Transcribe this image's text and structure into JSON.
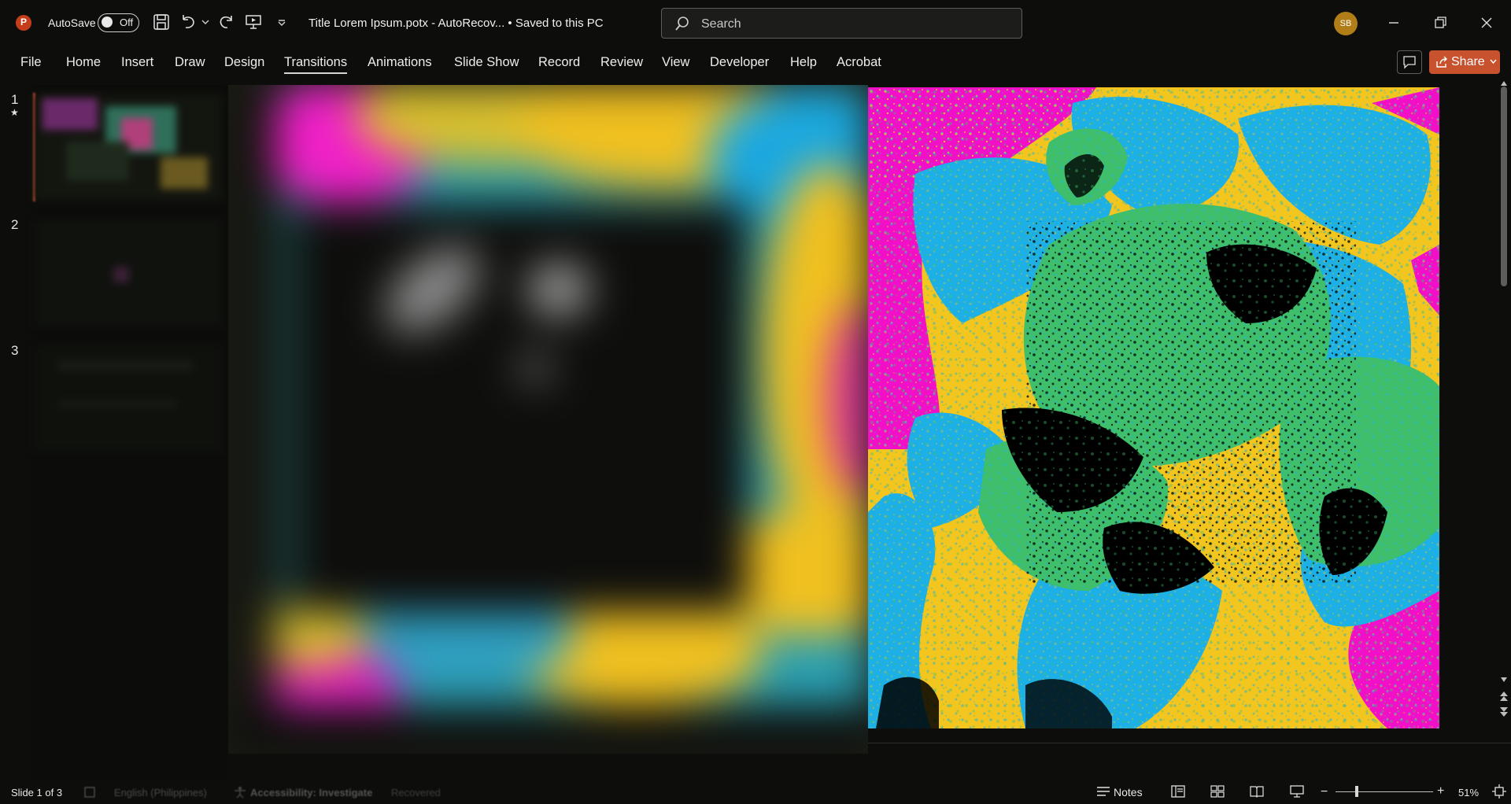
{
  "titlebar": {
    "autosave_label": "AutoSave",
    "autosave_state": "Off",
    "document_title": "Title Lorem Ipsum.potx  -  AutoRecov...  •  Saved to this PC",
    "search_placeholder": "Search",
    "user_initials": "SB"
  },
  "menu": {
    "tabs": [
      "File",
      "Home",
      "Insert",
      "Draw",
      "Design",
      "Transitions",
      "Animations",
      "Slide Show",
      "Record",
      "Review",
      "View",
      "Developer",
      "Help",
      "Acrobat"
    ],
    "active_tab": "Transitions",
    "share_label": "Share"
  },
  "slides": {
    "numbers": [
      "1",
      "2",
      "3"
    ],
    "star_marker": "★"
  },
  "status": {
    "slide_indicator": "Slide 1 of 3",
    "language": "English (Philippines)",
    "accessibility": "Accessibility: Investigate",
    "recovered": "Recovered",
    "notes_label": "Notes",
    "zoom_level": "51%"
  },
  "colors": {
    "accent_share": "#c8512e",
    "magenta": "#f20fc8",
    "yellow": "#f3c51f",
    "blue": "#1cb0e6",
    "green": "#3fbf6b",
    "black": "#000000"
  }
}
